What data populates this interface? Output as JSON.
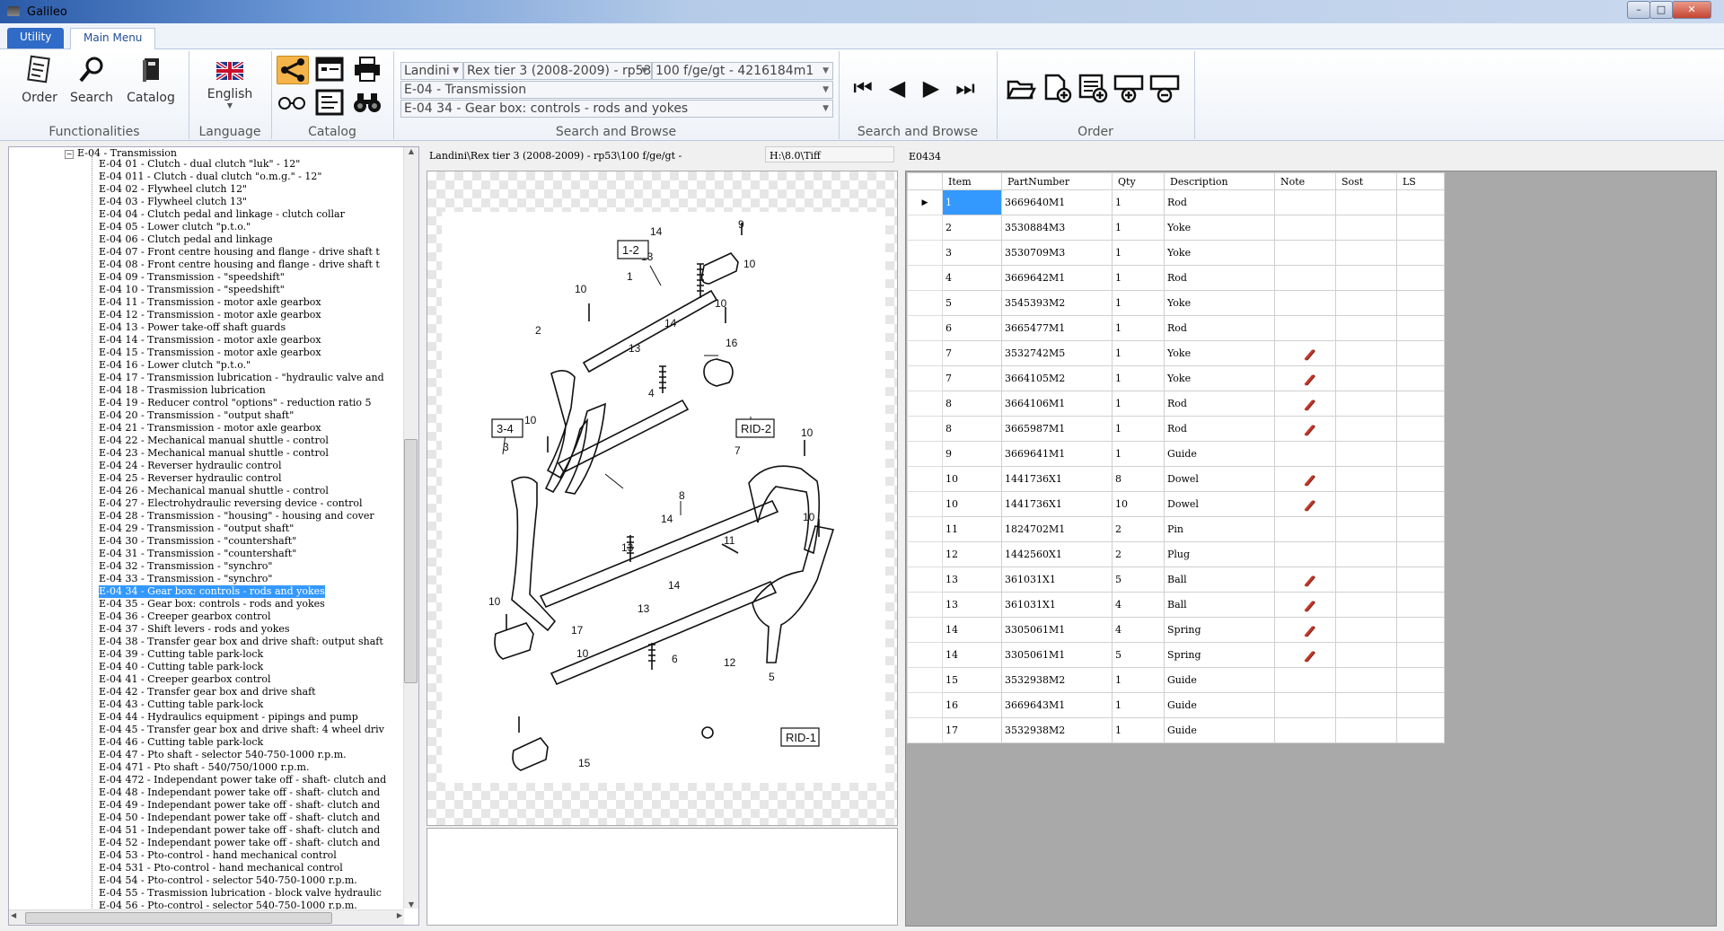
{
  "window": {
    "title": "Galileo"
  },
  "tabs": [
    {
      "label": "Utility"
    },
    {
      "label": "Main Menu"
    }
  ],
  "ribbon": {
    "functionalities": {
      "label": "Functionalities",
      "buttons": [
        {
          "label": "Order",
          "icon": "order-icon"
        },
        {
          "label": "Search",
          "icon": "search-icon"
        },
        {
          "label": "Catalog",
          "icon": "catalog-icon"
        }
      ]
    },
    "language": {
      "label": "Language",
      "current": "English",
      "icon": "uk-flag-icon"
    },
    "catalog": {
      "label": "Catalog"
    },
    "search_browse": {
      "label": "Search and Browse",
      "brand": "Landini",
      "model": "Rex tier 3 (2008-2009) - rp53",
      "variant": "100 f/ge/gt - 4216184m1",
      "group": "E-04 - Transmission",
      "section": "E-04 34 - Gear box: controls - rods and yokes"
    },
    "browse_nav": {
      "label": "Search and Browse"
    },
    "order": {
      "label": "Order"
    }
  },
  "tree": {
    "root": "E-04 - Transmission",
    "items": [
      "E-04 01 - Clutch - dual clutch \"luk\" - 12\"",
      "E-04 011 - Clutch - dual clutch \"o.m.g.\" - 12\"",
      "E-04 02 - Flywheel clutch 12\"",
      "E-04 03 - Flywheel clutch 13\"",
      "E-04 04 - Clutch pedal and linkage - clutch collar",
      "E-04 05 - Lower  clutch  \"p.t.o.\"",
      "E-04 06 - Clutch pedal and linkage",
      "E-04 07 - Front centre housing and flange - drive shaft t",
      "E-04 08 - Front centre housing and flange - drive shaft t",
      "E-04 09 - Transmission - \"speedshift\"",
      "E-04 10 - Transmission - \"speedshift\"",
      "E-04 11 - Transmission - motor axle gearbox",
      "E-04 12 - Transmission - motor axle gearbox",
      "E-04 13 - Power take-off shaft guards",
      "E-04 14 - Transmission - motor axle gearbox",
      "E-04 15 - Transmission - motor axle gearbox",
      "E-04 16 - Lower  clutch  \"p.t.o.\"",
      "E-04 17 - Transmission lubrication - \"hydraulic valve and",
      "E-04 18 - Trasmission lubrication",
      "E-04 19 - Reducer control  \"options\" - reduction ratio  5",
      "E-04 20 - Transmission - \"output shaft\"",
      "E-04 21 - Transmission - motor axle gearbox",
      "E-04 22 - Mechanical manual shuttle - control",
      "E-04 23 - Mechanical manual shuttle - control",
      "E-04 24 - Reverser hydraulic control",
      "E-04 25 - Reverser hydraulic control",
      "E-04 26 - Mechanical manual shuttle - control",
      "E-04 27 - Electrohydraulic  reversing device - control",
      "E-04 28 - Transmission - \"housing\" - housing and cover",
      "E-04 29 - Transmission - \"output shaft\"",
      "E-04 30 - Transmission - \"countershaft\"",
      "E-04 31 - Transmission - \"countershaft\"",
      "E-04 32 - Transmission - \"synchro\"",
      "E-04 33 - Transmission - \"synchro\"",
      "E-04 34 - Gear box: controls - rods and yokes",
      "E-04 35 - Gear box: controls - rods and yokes",
      "E-04 36 - Creeper gearbox control",
      "E-04 37 - Shift levers - rods and yokes",
      "E-04 38 - Transfer gear box and drive shaft: output shaft",
      "E-04 39 - Cutting table park-lock",
      "E-04 40 - Cutting table park-lock",
      "E-04 41 - Creeper gearbox control",
      "E-04 42 - Transfer gear box and drive shaft",
      "E-04 43 - Cutting table park-lock",
      "E-04 44 - Hydraulics equipment - pipings and pump",
      "E-04 45 - Transfer gear box and drive shaft: 4 wheel driv",
      "E-04 46 - Cutting table park-lock",
      "E-04 47 - Pto shaft - selector 540-750-1000 r.p.m.",
      "E-04 471 - Pto shaft - 540/750/1000 r.p.m.",
      "E-04 472 - Independant power take off - shaft- clutch and",
      "E-04 48 - Independant power take off - shaft- clutch and",
      "E-04 49 - Independant power take off - shaft- clutch and",
      "E-04 50 - Independant power take off - shaft- clutch and",
      "E-04 51 - Independant power take off - shaft- clutch and",
      "E-04 52 - Independant power take off - shaft- clutch and",
      "E-04 53 - Pto-control - hand mechanical control",
      "E-04 531 - Pto-control - hand mechanical control",
      "E-04 54 - Pto-control - selector 540-750-1000 r.p.m.",
      "E-04 55 - Trasmission lubrication - block valve hydraulic",
      "E-04 56 - Pto-control - selector 540-750-1000 r.p.m."
    ],
    "selected_index": 34
  },
  "image": {
    "path": "Landini\\Rex tier 3 (2008-2009) - rp53\\100 f/ge/gt -",
    "file": "H:\\8.0\\Tiff",
    "callouts": [
      "1-2",
      "1",
      "14",
      "13",
      "10",
      "9",
      "10",
      "2",
      "14",
      "13",
      "10",
      "16",
      "10",
      "3-4",
      "3",
      "4",
      "RID-2",
      "7",
      "10",
      "8",
      "14",
      "13",
      "11",
      "10",
      "10",
      "17",
      "14",
      "13",
      "6",
      "10",
      "12",
      "5",
      "15",
      "RID-1"
    ]
  },
  "parts": {
    "code": "E0434",
    "columns": [
      "Item",
      "PartNumber",
      "Qty",
      "Description",
      "Note",
      "Sost",
      "LS"
    ],
    "rows": [
      {
        "item": "1",
        "part": "3669640M1",
        "qty": "1",
        "desc": "Rod",
        "note": false
      },
      {
        "item": "2",
        "part": "3530884M3",
        "qty": "1",
        "desc": "Yoke",
        "note": false
      },
      {
        "item": "3",
        "part": "3530709M3",
        "qty": "1",
        "desc": "Yoke",
        "note": false
      },
      {
        "item": "4",
        "part": "3669642M1",
        "qty": "1",
        "desc": "Rod",
        "note": false
      },
      {
        "item": "5",
        "part": "3545393M2",
        "qty": "1",
        "desc": "Yoke",
        "note": false
      },
      {
        "item": "6",
        "part": "3665477M1",
        "qty": "1",
        "desc": "Rod",
        "note": false
      },
      {
        "item": "7",
        "part": "3532742M5",
        "qty": "1",
        "desc": "Yoke",
        "note": true
      },
      {
        "item": "7",
        "part": "3664105M2",
        "qty": "1",
        "desc": "Yoke",
        "note": true
      },
      {
        "item": "8",
        "part": "3664106M1",
        "qty": "1",
        "desc": "Rod",
        "note": true
      },
      {
        "item": "8",
        "part": "3665987M1",
        "qty": "1",
        "desc": "Rod",
        "note": true
      },
      {
        "item": "9",
        "part": "3669641M1",
        "qty": "1",
        "desc": "Guide",
        "note": false
      },
      {
        "item": "10",
        "part": "1441736X1",
        "qty": "8",
        "desc": "Dowel",
        "note": true
      },
      {
        "item": "10",
        "part": "1441736X1",
        "qty": "10",
        "desc": "Dowel",
        "note": true
      },
      {
        "item": "11",
        "part": "1824702M1",
        "qty": "2",
        "desc": "Pin",
        "note": false
      },
      {
        "item": "12",
        "part": "1442560X1",
        "qty": "2",
        "desc": "Plug",
        "note": false
      },
      {
        "item": "13",
        "part": "361031X1",
        "qty": "5",
        "desc": "Ball",
        "note": true
      },
      {
        "item": "13",
        "part": "361031X1",
        "qty": "4",
        "desc": "Ball",
        "note": true
      },
      {
        "item": "14",
        "part": "3305061M1",
        "qty": "4",
        "desc": "Spring",
        "note": true
      },
      {
        "item": "14",
        "part": "3305061M1",
        "qty": "5",
        "desc": "Spring",
        "note": true
      },
      {
        "item": "15",
        "part": "3532938M2",
        "qty": "1",
        "desc": "Guide",
        "note": false
      },
      {
        "item": "16",
        "part": "3669643M1",
        "qty": "1",
        "desc": "Guide",
        "note": false
      },
      {
        "item": "17",
        "part": "3532938M2",
        "qty": "1",
        "desc": "Guide",
        "note": false
      }
    ]
  },
  "colors": {
    "accent": "#3399ff",
    "tab_active": "#2f6bc7",
    "note_icon": "#c0392b",
    "grid_bg": "#a9a9a9"
  }
}
